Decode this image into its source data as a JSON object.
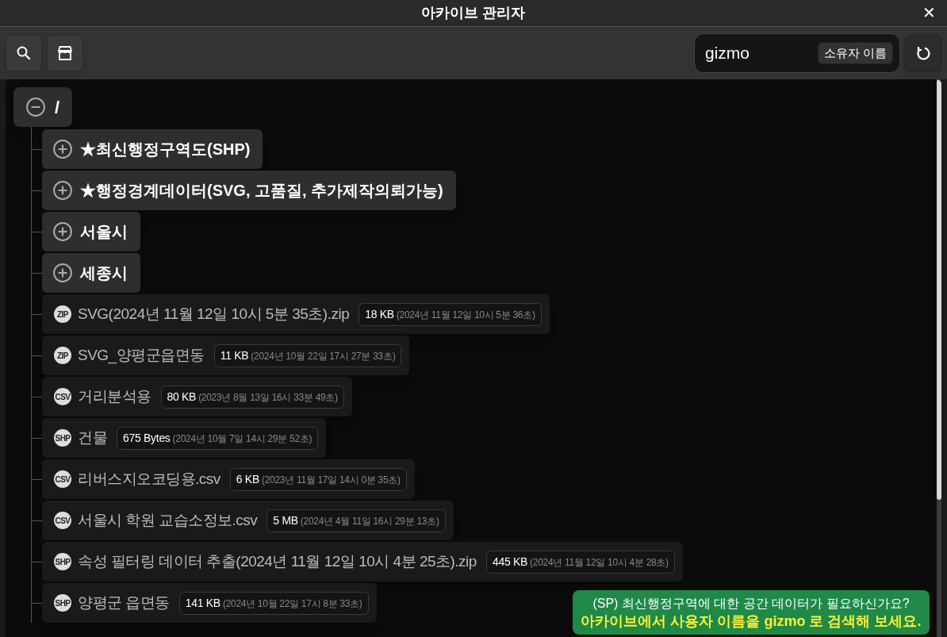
{
  "window": {
    "title": "아카이브 관리자",
    "close": "✕"
  },
  "toolbar": {
    "search_field": {
      "value": "gizmo",
      "badge": "소유자 이름"
    }
  },
  "tree": {
    "label": "/",
    "expanded": true,
    "children": [
      {
        "kind": "folder",
        "label": "★최신행정구역도(SHP)",
        "expanded": false
      },
      {
        "kind": "folder",
        "label": "★행정경계데이터(SVG, 고품질, 추가제작의뢰가능)",
        "expanded": false
      },
      {
        "kind": "folder",
        "label": "서울시",
        "expanded": false
      },
      {
        "kind": "folder",
        "label": "세종시",
        "expanded": false
      },
      {
        "kind": "file",
        "type": "ZIP",
        "label": "SVG(2024년 11월 12일 10시 5분 35초).zip",
        "size": "18 KB",
        "date": "(2024년 11월 12일 10시 5분 36초)"
      },
      {
        "kind": "file",
        "type": "ZIP",
        "label": "SVG_양평군읍면동",
        "size": "11 KB",
        "date": "(2024년 10월 22일 17시 27분 33초)"
      },
      {
        "kind": "file",
        "type": "CSV",
        "label": "거리분석용",
        "size": "80 KB",
        "date": "(2023년 8월 13일 16시 33분 49초)"
      },
      {
        "kind": "file",
        "type": "SHP",
        "label": "건물",
        "size": "675 Bytes",
        "date": "(2024년 10월 7일 14시 29분 52초)"
      },
      {
        "kind": "file",
        "type": "CSV",
        "label": "리버스지오코딩용.csv",
        "size": "6 KB",
        "date": "(2023년 11월 17일 14시 0분 35초)"
      },
      {
        "kind": "file",
        "type": "CSV",
        "label": "서울시 학원 교습소정보.csv",
        "size": "5 MB",
        "date": "(2024년 4월 11일 16시 29분 13초)"
      },
      {
        "kind": "file",
        "type": "SHP",
        "label": "속성 필터링 데이터 추출(2024년 11월 12일 10시 4분 25초).zip",
        "size": "445 KB",
        "date": "(2024년 11월 12일 10시 4분 28초)"
      },
      {
        "kind": "file",
        "type": "SHP",
        "label": "양평군 읍면동",
        "size": "141 KB",
        "date": "(2024년 10월 22일 17시 8분 33초)"
      }
    ]
  },
  "toast": {
    "line_1": "(SP) 최신행정구역에 대한 공간 데이터가 필요하신가요?",
    "line_2": "아카이브에서 사용자 이름을 gizmo 로 검색해 보세요."
  }
}
